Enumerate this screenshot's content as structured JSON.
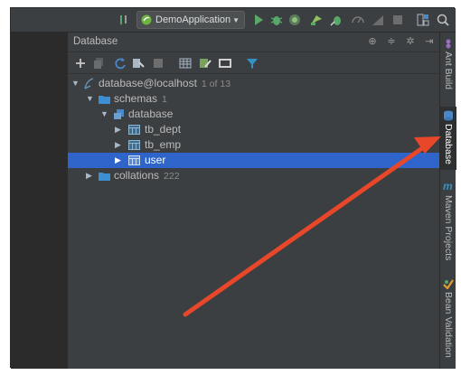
{
  "toolbar": {
    "run_config_label": "DemoApplication",
    "icons": [
      "build-icon",
      "run-icon",
      "debug-icon",
      "coverage-icon",
      "profile-icon",
      "attach-icon",
      "stop-icon",
      "structure-icon",
      "search-icon"
    ]
  },
  "database_panel": {
    "title": "Database",
    "header_icons": [
      "target-icon",
      "collapse-icon",
      "gear-icon",
      "hide-icon"
    ],
    "tool_icons": [
      "add-icon",
      "copy-icon",
      "refresh-icon",
      "properties-icon",
      "stop-icon",
      "table-icon",
      "edit-icon",
      "console-icon",
      "filter-icon"
    ]
  },
  "tree": [
    {
      "label": "database@localhost",
      "meta": "1 of 13",
      "icon": "datasource-icon",
      "expanded": true
    },
    {
      "label": "schemas",
      "meta": "1",
      "icon": "folder-icon",
      "expanded": true
    },
    {
      "label": "database",
      "meta": "",
      "icon": "schema-icon",
      "expanded": true
    },
    {
      "label": "tb_dept",
      "meta": "",
      "icon": "table-icon",
      "expanded": false
    },
    {
      "label": "tb_emp",
      "meta": "",
      "icon": "table-icon",
      "expanded": false
    },
    {
      "label": "user",
      "meta": "",
      "icon": "table-icon",
      "expanded": false,
      "selected": true
    },
    {
      "label": "collations",
      "meta": "222",
      "icon": "folder-icon",
      "expanded": false
    }
  ],
  "right_tabs": [
    {
      "label": "Ant Build",
      "icon": "ant-icon"
    },
    {
      "label": "Database",
      "icon": "database-icon",
      "active": true
    },
    {
      "label": "Maven Projects",
      "icon": "maven-icon"
    },
    {
      "label": "Bean Validation",
      "icon": "bean-icon"
    }
  ],
  "colors": {
    "selection": "#2f65ca",
    "annotation_arrow": "#e8472a",
    "panel_bg": "#3c3f41"
  }
}
